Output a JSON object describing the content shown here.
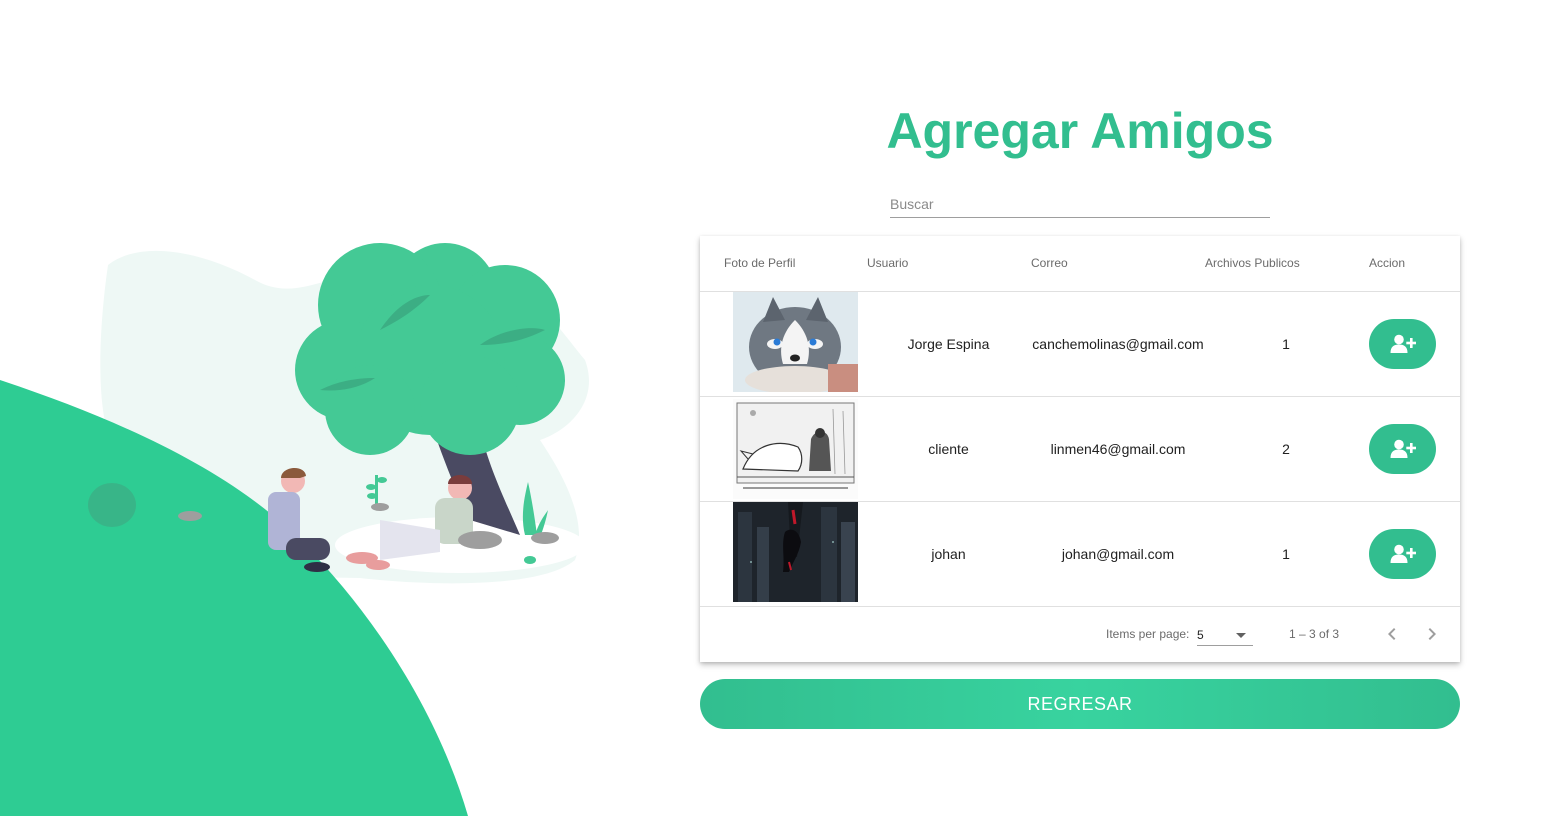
{
  "page": {
    "title": "Agregar Amigos",
    "accent_color": "#32be8f"
  },
  "search": {
    "placeholder": "Buscar",
    "value": ""
  },
  "table": {
    "headers": [
      "Foto de Perfil",
      "Usuario",
      "Correo",
      "Archivos Publicos",
      "Accion"
    ],
    "rows": [
      {
        "photo": "husky-photo",
        "user": "Jorge Espina",
        "email": "canchemolinas@gmail.com",
        "files": "1",
        "action_icon": "add-user-icon"
      },
      {
        "photo": "sketch-photo",
        "user": "cliente",
        "email": "linmen46@gmail.com",
        "files": "2",
        "action_icon": "add-user-icon"
      },
      {
        "photo": "dark-city-photo",
        "user": "johan",
        "email": "johan@gmail.com",
        "files": "1",
        "action_icon": "add-user-icon"
      }
    ]
  },
  "paginator": {
    "items_per_page_label": "Items per page:",
    "page_size": "5",
    "range_label": "1 – 3 of 3",
    "prev_icon": "chevron-left-icon",
    "next_icon": "chevron-right-icon"
  },
  "back_button": {
    "label": "REGRESAR"
  }
}
